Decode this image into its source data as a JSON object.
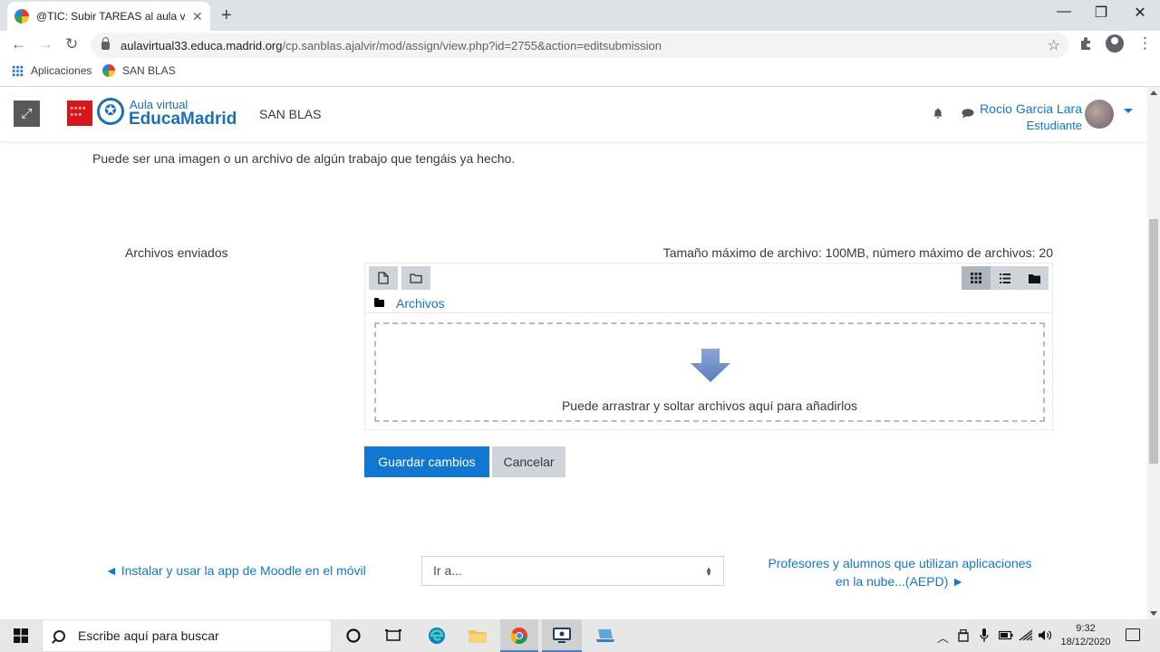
{
  "browser": {
    "tab_title": "@TIC: Subir TAREAS al aula virtual",
    "url_host": "aulavirtual33.educa.madrid.org",
    "url_path": "/cp.sanblas.ajalvir/mod/assign/view.php?id=2755&action=editsubmission",
    "bookmarks": [
      {
        "label": "Aplicaciones",
        "icon": "apps-icon"
      },
      {
        "label": "SAN BLAS",
        "icon": "site-favicon"
      }
    ]
  },
  "header": {
    "brand_small": "Aula virtual",
    "brand_big": "EducaMadrid",
    "site_name": "SAN BLAS",
    "user_name": "Rocio Garcia Lara",
    "user_role": "Estudiante"
  },
  "content": {
    "intro_text": "Puede ser una imagen o un archivo de algún trabajo que tengáis ya hecho.",
    "field_label": "Archivos enviados",
    "limits_text": "Tamaño máximo de archivo: 100MB, número máximo de archivos: 20",
    "path_label": "Archivos",
    "drop_text": "Puede arrastrar y soltar archivos aquí para añadirlos",
    "save_label": "Guardar cambios",
    "cancel_label": "Cancelar"
  },
  "footer_nav": {
    "prev_link": "◄ Instalar y usar la app de Moodle en el móvil",
    "jump_placeholder": "Ir a...",
    "next_link_line1": "Profesores y alumnos que utilizan aplicaciones",
    "next_link_line2": "en la nube...(AEPD) ►"
  },
  "taskbar": {
    "search_placeholder": "Escribe aquí para buscar",
    "time": "9:32",
    "date": "18/12/2020"
  },
  "colors": {
    "moodle_blue": "#1177d1",
    "brand_blue": "#1d6fb8",
    "comunidad_red": "#d7151a"
  }
}
